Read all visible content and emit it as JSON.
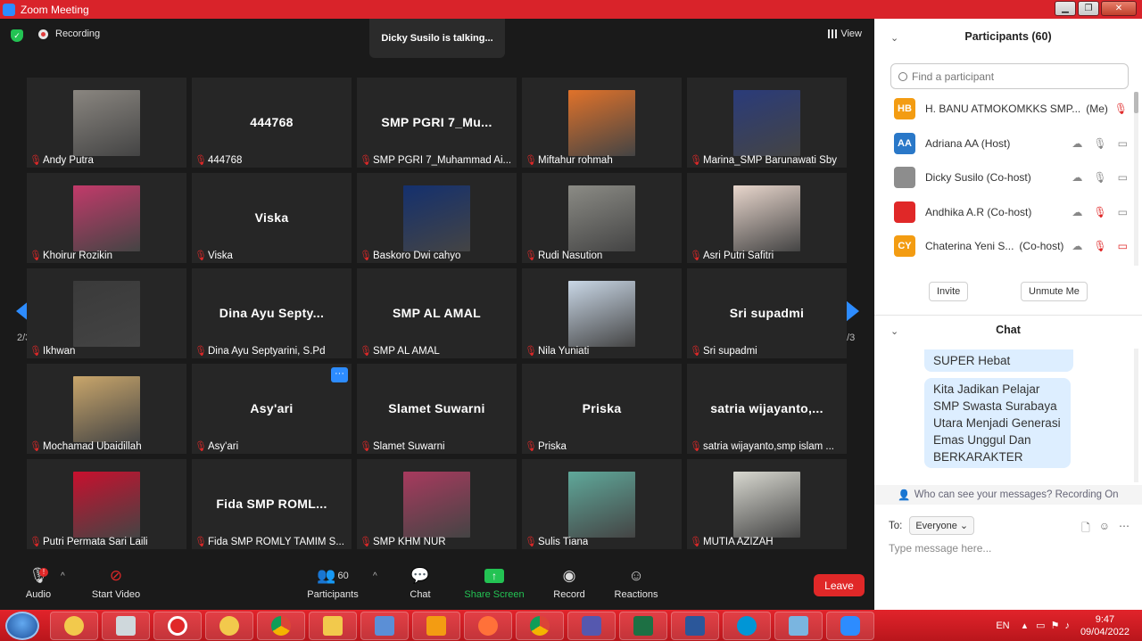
{
  "window": {
    "title": "Zoom Meeting"
  },
  "topbar": {
    "recording_label": "Recording",
    "talking": "Dicky Susilo is talking...",
    "view_label": "View"
  },
  "paging": {
    "left": "2/3",
    "right": "2/3"
  },
  "tiles": [
    {
      "name": "Andy Putra",
      "big": "",
      "photo": "#8a8680"
    },
    {
      "name": "444768",
      "big": "444768",
      "photo": ""
    },
    {
      "name": "SMP PGRI 7_Muhammad Ai...",
      "big": "SMP PGRI 7_Mu...",
      "photo": ""
    },
    {
      "name": "Miftahur rohmah",
      "big": "",
      "photo": "#e0722a"
    },
    {
      "name": "Marina_SMP Barunawati Sby",
      "big": "",
      "photo": "#2a3b7a"
    },
    {
      "name": "Khoirur Rozikin",
      "big": "",
      "photo": "#c23a6a"
    },
    {
      "name": "Viska",
      "big": "Viska",
      "photo": ""
    },
    {
      "name": "Baskoro Dwi cahyo",
      "big": "",
      "photo": "#14306e"
    },
    {
      "name": "Rudi Nasution",
      "big": "",
      "photo": "#8b8b85"
    },
    {
      "name": "Asri Putri Safitri",
      "big": "",
      "photo": "#e8d6cc"
    },
    {
      "name": "Ikhwan",
      "big": "",
      "photo": "#3a3a3a"
    },
    {
      "name": "Dina Ayu Septyarini, S.Pd",
      "big": "Dina Ayu Septy...",
      "photo": ""
    },
    {
      "name": "SMP AL AMAL",
      "big": "SMP AL AMAL",
      "photo": ""
    },
    {
      "name": "Nila Yuniati",
      "big": "",
      "photo": "#c9d7e6"
    },
    {
      "name": "Sri supadmi",
      "big": "Sri supadmi",
      "photo": ""
    },
    {
      "name": "Mochamad Ubaidillah",
      "big": "",
      "photo": "#c9a66b"
    },
    {
      "name": "Asy'ari",
      "big": "Asy'ari",
      "photo": ""
    },
    {
      "name": "Slamet Suwarni",
      "big": "Slamet Suwarni",
      "photo": ""
    },
    {
      "name": "Priska",
      "big": "Priska",
      "photo": ""
    },
    {
      "name": "satria wijayanto,smp islam ...",
      "big": "satria  wijayanto,...",
      "photo": ""
    },
    {
      "name": "Putri Permata Sari Laili",
      "big": "",
      "photo": "#c8102e"
    },
    {
      "name": "Fida SMP ROMLY TAMIM S...",
      "big": "Fida SMP ROML...",
      "photo": ""
    },
    {
      "name": "SMP KHM NUR",
      "big": "",
      "photo": "#a83a5e"
    },
    {
      "name": "Sulis Tiana",
      "big": "",
      "photo": "#5fa89a"
    },
    {
      "name": "MUTIA AZIZAH",
      "big": "",
      "photo": "#d8d8d0"
    }
  ],
  "toolbar": {
    "audio": "Audio",
    "start_video": "Start Video",
    "participants": "Participants",
    "participants_count": "60",
    "chat": "Chat",
    "share": "Share Screen",
    "record": "Record",
    "reactions": "Reactions",
    "leave": "Leave",
    "audio_alert": "!"
  },
  "panel": {
    "participants_title": "Participants (60)",
    "search_placeholder": "Find a participant",
    "participants": [
      {
        "initials": "HB",
        "name": "H. BANU ATMOKOMKKS SMP...",
        "role": "(Me)",
        "color": "#f39c12"
      },
      {
        "initials": "AA",
        "name": "Adriana AA (Host)",
        "role": "",
        "color": "#2a78c8"
      },
      {
        "initials": "",
        "name": "Dicky Susilo (Co-host)",
        "role": "",
        "color": "#8d8d8d"
      },
      {
        "initials": "",
        "name": "Andhika A.R (Co-host)",
        "role": "",
        "color": "#e02828"
      },
      {
        "initials": "CY",
        "name": "Chaterina Yeni S...",
        "role": "(Co-host)",
        "color": "#f39c12"
      }
    ],
    "invite": "Invite",
    "unmute": "Unmute Me",
    "chat_title": "Chat",
    "messages": [
      "SUPER Hebat",
      "Kita Jadikan Pelajar SMP Swasta Surabaya Utara Menjadi Generasi Emas Unggul Dan BERKARAKTER"
    ],
    "privacy": "Who can see your messages? Recording On",
    "to_label": "To:",
    "to_value": "Everyone",
    "input_placeholder": "Type message here..."
  },
  "taskbar": {
    "lang": "EN",
    "time": "9:47",
    "date": "09/04/2022"
  }
}
